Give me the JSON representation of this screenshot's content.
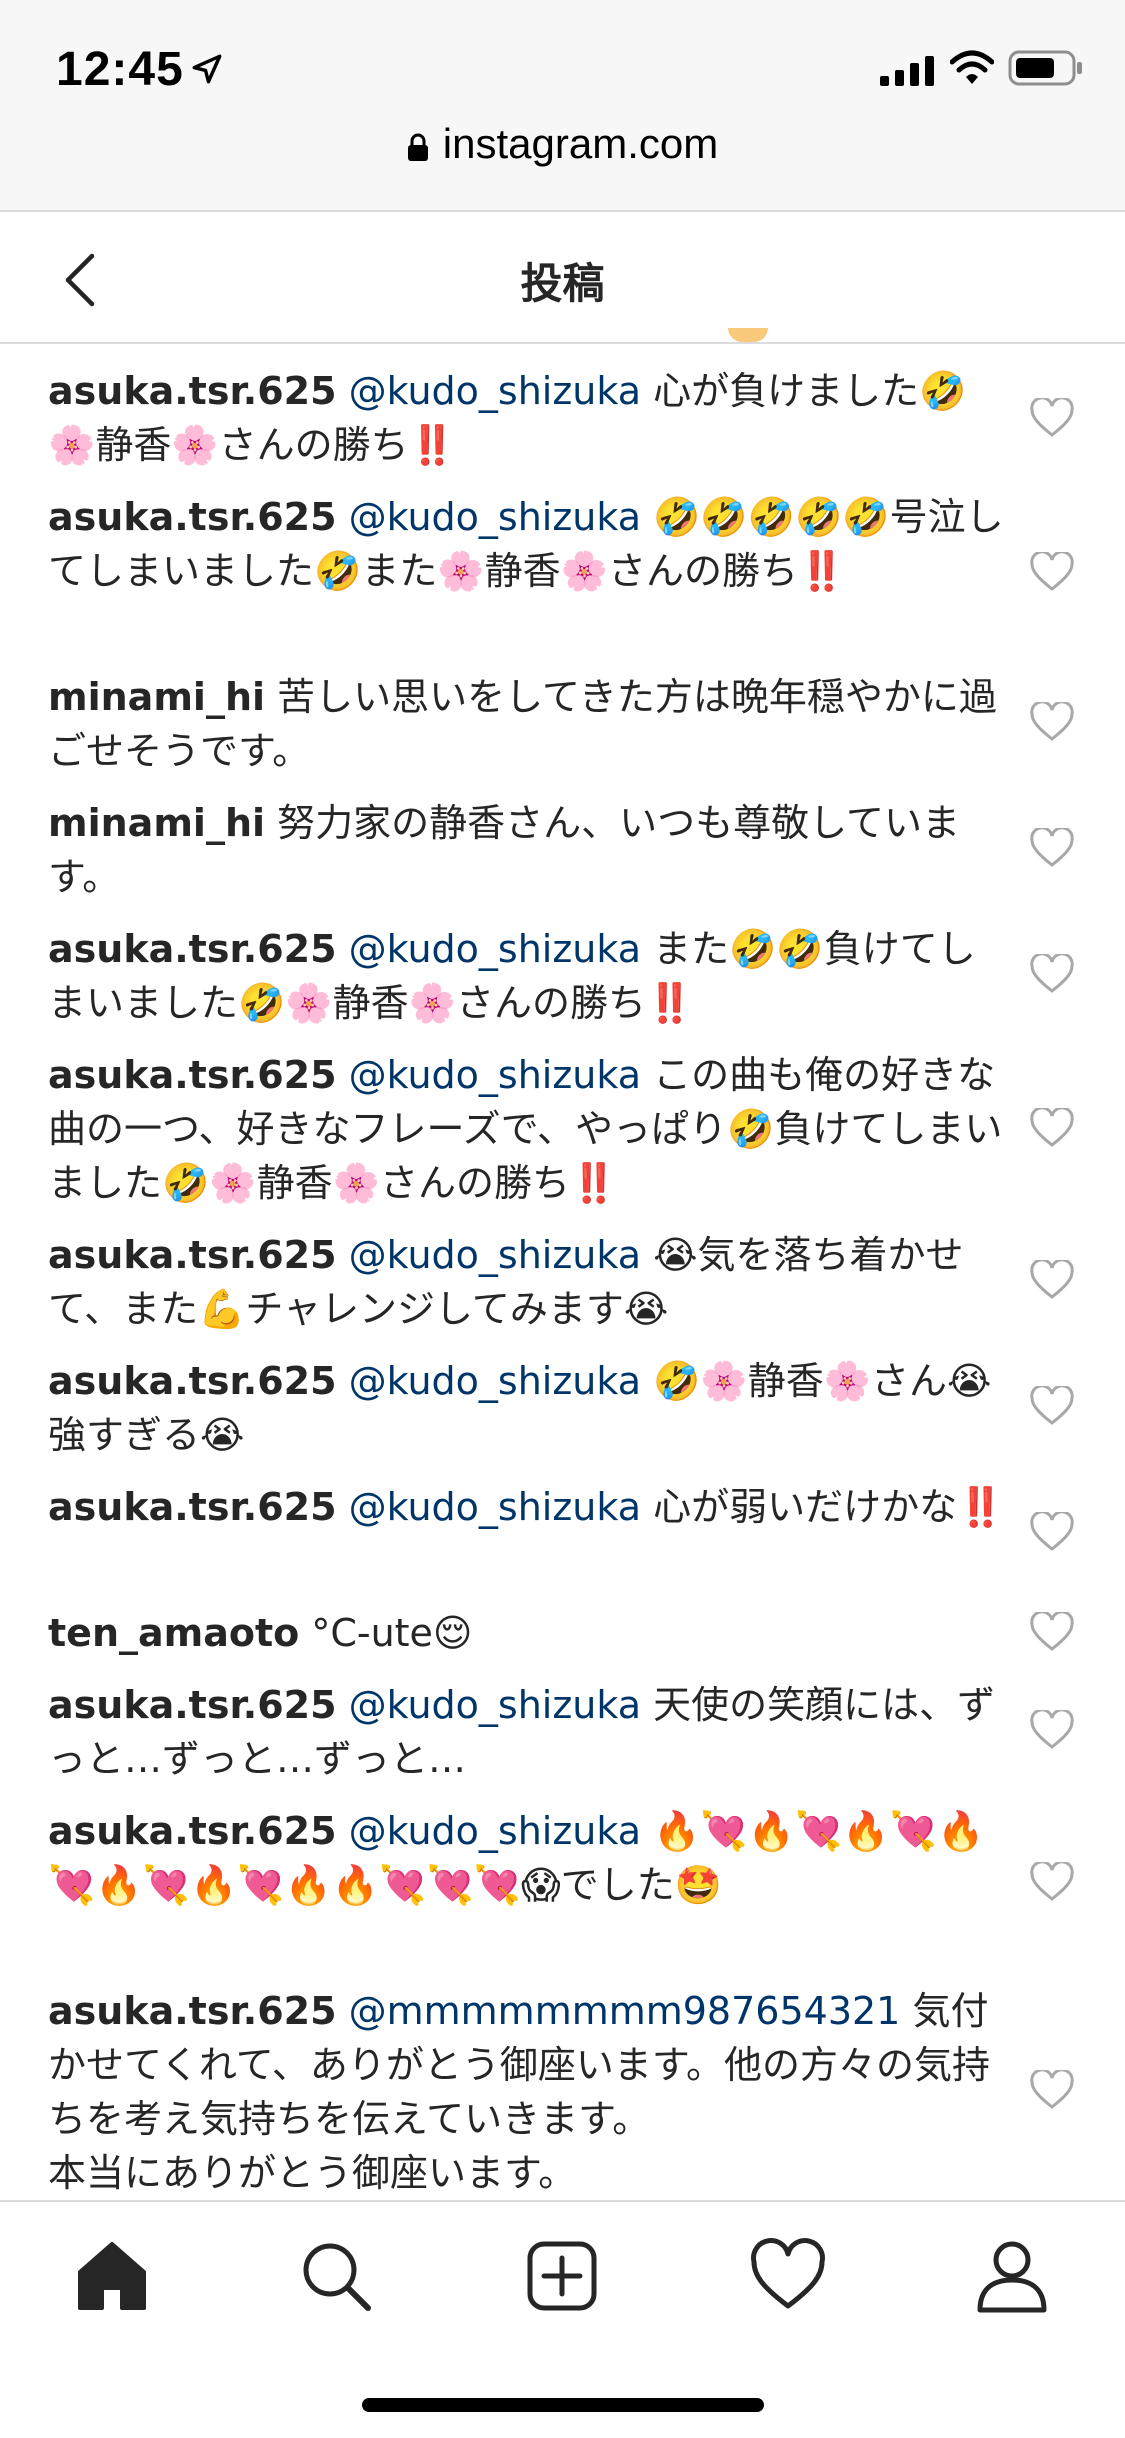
{
  "status_bar": {
    "time": "12:45"
  },
  "url_bar": {
    "url": "instagram.com"
  },
  "header": {
    "title": "投稿"
  },
  "comments": [
    {
      "user": "asuka.tsr.625",
      "mention": "@kudo_shizuka",
      "text": " 心が負けました🤣🌸静香🌸さんの勝ち‼️"
    },
    {
      "user": "asuka.tsr.625",
      "mention": "@kudo_shizuka",
      "text": " 🤣🤣🤣🤣🤣号泣してしまいました🤣また🌸静香🌸さんの勝ち‼️"
    },
    {
      "user": "minami_hi",
      "mention": "",
      "text": " 苦しい思いをしてきた方は晩年穏やかに過ごせそうです。"
    },
    {
      "user": "minami_hi",
      "mention": "",
      "text": " 努力家の静香さん、いつも尊敬しています。"
    },
    {
      "user": "asuka.tsr.625",
      "mention": "@kudo_shizuka",
      "text": " また🤣🤣負けてしまいました🤣🌸静香🌸さんの勝ち‼️"
    },
    {
      "user": "asuka.tsr.625",
      "mention": "@kudo_shizuka",
      "text": " この曲も俺の好きな曲の一つ、好きなフレーズで、やっぱり🤣負けてしまいました🤣🌸静香🌸さんの勝ち‼️"
    },
    {
      "user": "asuka.tsr.625",
      "mention": "@kudo_shizuka",
      "text": " 😭気を落ち着かせて、また💪チャレンジしてみます😭"
    },
    {
      "user": "asuka.tsr.625",
      "mention": "@kudo_shizuka",
      "text": " 🤣🌸静香🌸さん😭強すぎる😭"
    },
    {
      "user": "asuka.tsr.625",
      "mention": "@kudo_shizuka",
      "text": " 心が弱いだけかな‼️"
    },
    {
      "user": "ten_amaoto",
      "mention": "",
      "text": " °C-ute😌"
    },
    {
      "user": "asuka.tsr.625",
      "mention": "@kudo_shizuka",
      "text": " 天使の笑顔には、ずっと…ずっと…ずっと…"
    },
    {
      "user": "asuka.tsr.625",
      "mention": "@kudo_shizuka",
      "text": " 🔥💘🔥💘🔥💘🔥💘🔥💘🔥💘🔥🔥💘💘💘😱でした🤩"
    },
    {
      "user": "asuka.tsr.625",
      "mention": "@mmmmmmmm987654321",
      "text": " 気付かせてくれて、ありがとう御座います。他の方々の気持ちを考え気持ちを伝えていきます。\n本当にありがとう御座います。"
    }
  ],
  "bottom_nav": [
    {
      "name": "home-icon"
    },
    {
      "name": "search-icon"
    },
    {
      "name": "new-post-icon"
    },
    {
      "name": "activity-heart-icon"
    },
    {
      "name": "profile-icon"
    }
  ],
  "colors": {
    "mention": "#003569",
    "text": "#262626",
    "border": "#dbdbdb",
    "bar": "#f7f7f7"
  }
}
